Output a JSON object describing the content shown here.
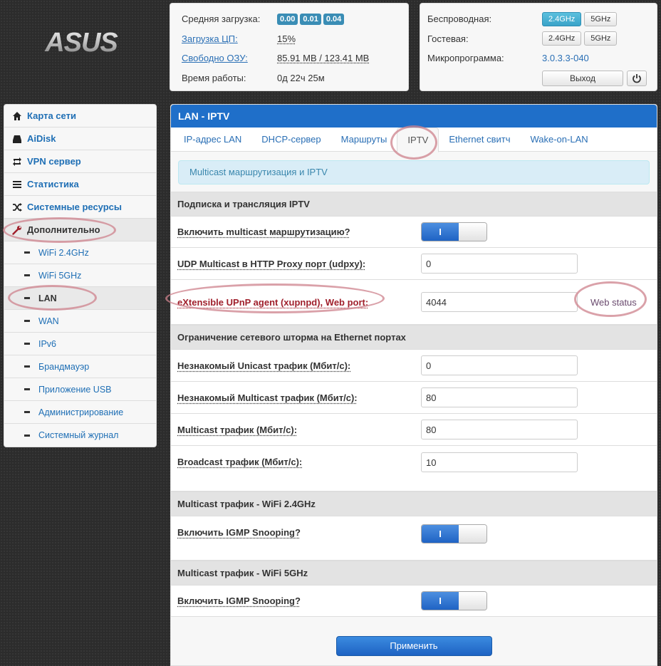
{
  "brand": {
    "logo_text": "ASUS"
  },
  "status": {
    "load_label": "Средняя загрузка:",
    "load_values": [
      "0.00",
      "0.01",
      "0.04"
    ],
    "cpu_label": "Загрузка ЦП:",
    "cpu_value": "15%",
    "ram_label": "Свободно ОЗУ:",
    "ram_value": "85.91 MB / 123.41 MB",
    "uptime_label": "Время работы:",
    "uptime_value": "0д 22ч 25м"
  },
  "wireless": {
    "wireless_label": "Беспроводная:",
    "guest_label": "Гостевая:",
    "firmware_label": "Микропрограмма:",
    "firmware_value": "3.0.3.3-040",
    "band_24": "2.4GHz",
    "band_5": "5GHz",
    "logout_label": "Выход"
  },
  "sidebar": {
    "items": [
      {
        "label": "Карта сети",
        "icon": "home-icon"
      },
      {
        "label": "AiDisk",
        "icon": "hdd-icon"
      },
      {
        "label": "VPN сервер",
        "icon": "retweet-icon"
      },
      {
        "label": "Статистика",
        "icon": "list-icon"
      },
      {
        "label": "Системные ресурсы",
        "icon": "random-icon"
      },
      {
        "label": "Дополнительно",
        "icon": "wrench-icon"
      }
    ],
    "subitems": [
      "WiFi 2.4GHz",
      "WiFi 5GHz",
      "LAN",
      "WAN",
      "IPv6",
      "Брандмауэр",
      "Приложение USB",
      "Администрирование",
      "Системный журнал"
    ]
  },
  "main": {
    "title": "LAN - IPTV",
    "tabs": [
      "IP-адрес LAN",
      "DHCP-сервер",
      "Маршруты",
      "IPTV",
      "Ethernet свитч",
      "Wake-on-LAN"
    ],
    "info": "Multicast маршрутизация и IPTV",
    "section1": {
      "title": "Подписка и трансляция IPTV",
      "multicast_routing_label": "Включить multicast маршрутизацию?",
      "udpxy_label": "UDP Multicast в HTTP Proxy порт (udpxy):",
      "udpxy_value": "0",
      "xupnpd_label": "eXtensible UPnP agent (xupnpd), Web port:",
      "xupnpd_value": "4044",
      "web_status": "Web status"
    },
    "section2": {
      "title": "Ограничение сетевого шторма на Ethernet портах",
      "unicast_label": "Незнакомый Unicast трафик (Мбит/с):",
      "unicast_value": "0",
      "unk_multicast_label": "Незнакомый Multicast трафик (Мбит/с):",
      "unk_multicast_value": "80",
      "multicast_label": "Multicast трафик (Мбит/с):",
      "multicast_value": "80",
      "broadcast_label": "Broadcast трафик (Мбит/с):",
      "broadcast_value": "10"
    },
    "section3": {
      "title": "Multicast трафик - WiFi 2.4GHz",
      "igmp_label": "Включить IGMP Snooping?"
    },
    "section4": {
      "title": "Multicast трафик - WiFi 5GHz",
      "igmp_label": "Включить IGMP Snooping?"
    },
    "toggle_on": "I",
    "apply_label": "Применить"
  },
  "colors": {
    "header_blue": "#1f6fc9",
    "link_blue": "#2a6fb5",
    "badge_blue": "#3a8db5",
    "highlight_oval": "#cd828c"
  }
}
